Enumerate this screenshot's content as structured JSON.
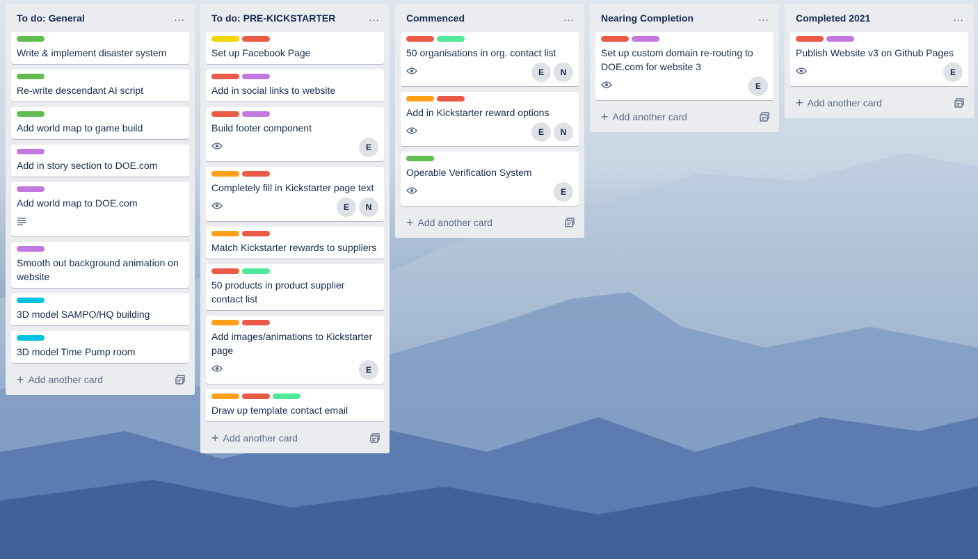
{
  "colors": {
    "green": "#61bd4f",
    "yellow": "#f2d600",
    "orange": "#ff9f1a",
    "red": "#eb5a46",
    "purple": "#c377e0",
    "sky": "#00c2e0",
    "lime": "#51e898"
  },
  "add_card_label": "Add another card",
  "lists": [
    {
      "title": "To do: General",
      "cards": [
        {
          "labels": [
            "green"
          ],
          "title": "Write & implement disaster system",
          "watch": false,
          "desc": false,
          "members": []
        },
        {
          "labels": [
            "green"
          ],
          "title": "Re-write descendant AI script",
          "watch": false,
          "desc": false,
          "members": []
        },
        {
          "labels": [
            "green"
          ],
          "title": "Add world map to game build",
          "watch": false,
          "desc": false,
          "members": []
        },
        {
          "labels": [
            "purple"
          ],
          "title": "Add in story section to DOE.com",
          "watch": false,
          "desc": false,
          "members": []
        },
        {
          "labels": [
            "purple"
          ],
          "title": "Add world map to DOE.com",
          "watch": false,
          "desc": true,
          "members": []
        },
        {
          "labels": [
            "purple"
          ],
          "title": "Smooth out background animation on website",
          "watch": false,
          "desc": false,
          "members": []
        },
        {
          "labels": [
            "sky"
          ],
          "title": "3D model SAMPO/HQ building",
          "watch": false,
          "desc": false,
          "members": []
        },
        {
          "labels": [
            "sky"
          ],
          "title": "3D model Time Pump room",
          "watch": false,
          "desc": false,
          "members": []
        }
      ]
    },
    {
      "title": "To do: PRE-KICKSTARTER",
      "cards": [
        {
          "labels": [
            "yellow",
            "red"
          ],
          "title": "Set up Facebook Page",
          "watch": false,
          "desc": false,
          "members": []
        },
        {
          "labels": [
            "red",
            "purple"
          ],
          "title": "Add in social links to website",
          "watch": false,
          "desc": false,
          "members": []
        },
        {
          "labels": [
            "red",
            "purple"
          ],
          "title": "Build footer component",
          "watch": true,
          "desc": false,
          "members": [
            "E"
          ]
        },
        {
          "labels": [
            "orange",
            "red"
          ],
          "title": "Completely fill in Kickstarter page text",
          "watch": true,
          "desc": false,
          "members": [
            "E",
            "N"
          ]
        },
        {
          "labels": [
            "orange",
            "red"
          ],
          "title": "Match Kickstarter rewards to suppliers",
          "watch": false,
          "desc": false,
          "members": []
        },
        {
          "labels": [
            "red",
            "lime"
          ],
          "title": "50 products in product supplier contact list",
          "watch": false,
          "desc": false,
          "members": []
        },
        {
          "labels": [
            "orange",
            "red"
          ],
          "title": "Add images/animations to Kickstarter page",
          "watch": true,
          "desc": false,
          "members": [
            "E"
          ]
        },
        {
          "labels": [
            "orange",
            "red",
            "lime"
          ],
          "title": "Draw up template contact email",
          "watch": false,
          "desc": false,
          "members": []
        }
      ]
    },
    {
      "title": "Commenced",
      "cards": [
        {
          "labels": [
            "red",
            "lime"
          ],
          "title": "50 organisations in org. contact list",
          "watch": true,
          "desc": false,
          "members": [
            "E",
            "N"
          ]
        },
        {
          "labels": [
            "orange",
            "red"
          ],
          "title": "Add in Kickstarter reward options",
          "watch": true,
          "desc": false,
          "members": [
            "E",
            "N"
          ]
        },
        {
          "labels": [
            "green"
          ],
          "title": "Operable Verification System",
          "watch": true,
          "desc": false,
          "members": [
            "E"
          ]
        }
      ]
    },
    {
      "title": "Nearing Completion",
      "cards": [
        {
          "labels": [
            "red",
            "purple"
          ],
          "title": "Set up custom domain re-routing to DOE.com for website 3",
          "watch": true,
          "desc": false,
          "members": [
            "E"
          ]
        }
      ]
    },
    {
      "title": "Completed 2021",
      "cards": [
        {
          "labels": [
            "red",
            "purple"
          ],
          "title": "Publish Website v3 on Github Pages",
          "watch": true,
          "desc": false,
          "members": [
            "E"
          ]
        }
      ]
    }
  ]
}
